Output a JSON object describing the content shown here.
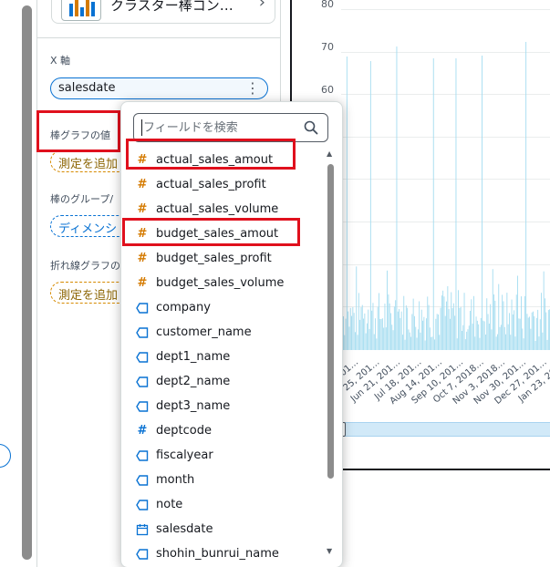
{
  "visual": {
    "title": "クラスター棒コン…"
  },
  "wells": {
    "x_axis": {
      "label": "X 軸",
      "value": "salesdate",
      "menu": "⋮"
    },
    "bar_values": {
      "label": "棒グラフの値",
      "add": "測定を追加"
    },
    "bar_group": {
      "label": "棒のグループ/",
      "add": "ディメンシ"
    },
    "line_values": {
      "label": "折れ線グラフの",
      "add": "測定を追加"
    }
  },
  "chart": {
    "yticks": [
      "80",
      "70",
      "60"
    ],
    "xticks": [
      "…201…",
      "…ay 25, 201…",
      "Jun 21, 201…",
      "Jul 18, 201…",
      "Aug 14, 201…",
      "Sep 10, 201…",
      "Oct 7, 2018…",
      "Nov 3, 2018…",
      "Nov 30, 201…",
      "Dec 27, 201…",
      "Jan 23, 201…",
      "Feb 19…"
    ],
    "bar_color": "#a4dcf0"
  },
  "dropdown": {
    "search": {
      "placeholder": "フィールドを検索"
    },
    "fields": [
      {
        "name": "actual_sales_amout",
        "icon": "measure-hash-icon"
      },
      {
        "name": "actual_sales_profit",
        "icon": "measure-hash-icon"
      },
      {
        "name": "actual_sales_volume",
        "icon": "measure-hash-icon"
      },
      {
        "name": "budget_sales_amout",
        "icon": "measure-hash-icon"
      },
      {
        "name": "budget_sales_profit",
        "icon": "measure-hash-icon"
      },
      {
        "name": "budget_sales_volume",
        "icon": "measure-hash-icon"
      },
      {
        "name": "company",
        "icon": "dimension-tag-icon"
      },
      {
        "name": "customer_name",
        "icon": "dimension-tag-icon"
      },
      {
        "name": "dept1_name",
        "icon": "dimension-tag-icon"
      },
      {
        "name": "dept2_name",
        "icon": "dimension-tag-icon"
      },
      {
        "name": "dept3_name",
        "icon": "dimension-tag-icon"
      },
      {
        "name": "deptcode",
        "icon": "dimension-hash-icon"
      },
      {
        "name": "fiscalyear",
        "icon": "dimension-tag-icon"
      },
      {
        "name": "month",
        "icon": "dimension-tag-icon"
      },
      {
        "name": "note",
        "icon": "dimension-tag-icon"
      },
      {
        "name": "salesdate",
        "icon": "calendar-icon"
      },
      {
        "name": "shohin_bunrui_name",
        "icon": "dimension-tag-icon"
      }
    ]
  }
}
